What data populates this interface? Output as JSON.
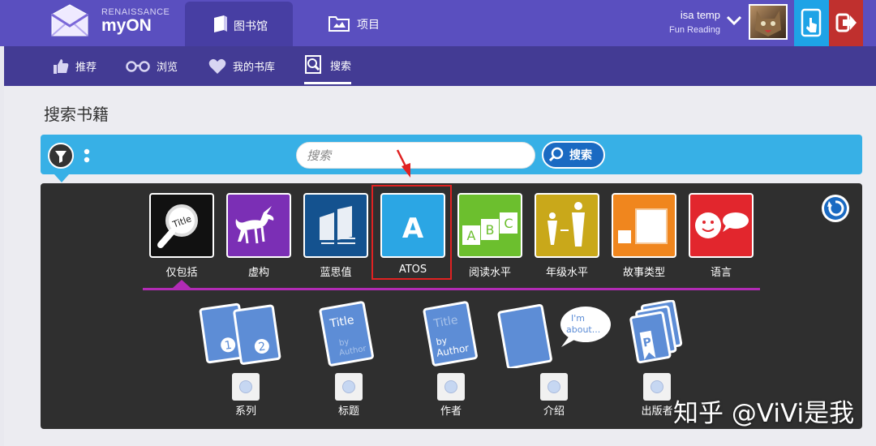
{
  "header": {
    "brand_small": "RENAISSANCE",
    "brand_big": "myON",
    "tabs": [
      {
        "label": "图书馆",
        "icon": "book-icon",
        "active": true
      },
      {
        "label": "项目",
        "icon": "folder-icon",
        "active": false
      }
    ],
    "user": {
      "name": "isa temp",
      "role": "Fun Reading"
    },
    "colors": {
      "header": "#5a4fbf",
      "active_tab": "#473ea3",
      "tablet_button": "#1ea3e6",
      "exit_button": "#c0302e"
    }
  },
  "subnav": {
    "items": [
      {
        "label": "推荐",
        "icon": "thumbs-up-icon"
      },
      {
        "label": "浏览",
        "icon": "glasses-icon"
      },
      {
        "label": "我的书库",
        "icon": "heart-icon"
      },
      {
        "label": "搜索",
        "icon": "search-book-icon",
        "active": true
      }
    ]
  },
  "page": {
    "title": "搜索书籍"
  },
  "search": {
    "placeholder": "搜索",
    "button_label": "搜索",
    "bar_color": "#37b0e6"
  },
  "filters": {
    "tiles": [
      {
        "label": "仅包括",
        "icon": "magnifier-title-icon",
        "color": "#111111",
        "selected": true
      },
      {
        "label": "虚构",
        "icon": "unicorn-icon",
        "color": "#7b2fb5"
      },
      {
        "label": "蓝思值",
        "icon": "lexile-books-icon",
        "color": "#14528f"
      },
      {
        "label": "ATOS",
        "icon": "letter-a-icon",
        "color": "#2ba6e4",
        "letter": "A"
      },
      {
        "label": "阅读水平",
        "icon": "abc-blocks-icon",
        "color": "#6cbf2e",
        "letters": [
          "A",
          "B",
          "C"
        ]
      },
      {
        "label": "年级水平",
        "icon": "growth-figures-icon",
        "color": "#c9a81a"
      },
      {
        "label": "故事类型",
        "icon": "story-pages-icon",
        "color": "#f0861e"
      },
      {
        "label": "语言",
        "icon": "speech-face-icon",
        "color": "#e2262d"
      }
    ],
    "options": [
      {
        "label": "系列",
        "icon": "series-books-icon",
        "numbers": [
          "1",
          "2"
        ]
      },
      {
        "label": "标题",
        "icon": "title-book-icon",
        "text": [
          "Title",
          "by",
          "Author"
        ]
      },
      {
        "label": "作者",
        "icon": "author-book-icon",
        "text": [
          "Title",
          "by",
          "Author"
        ]
      },
      {
        "label": "介绍",
        "icon": "about-book-icon",
        "text": [
          "I'm",
          "about..."
        ]
      },
      {
        "label": "出版者",
        "icon": "publisher-books-icon",
        "letter": "P"
      }
    ],
    "selection_color": "#b22bb5"
  },
  "watermark": {
    "text": "知乎 @ViVi是我"
  }
}
